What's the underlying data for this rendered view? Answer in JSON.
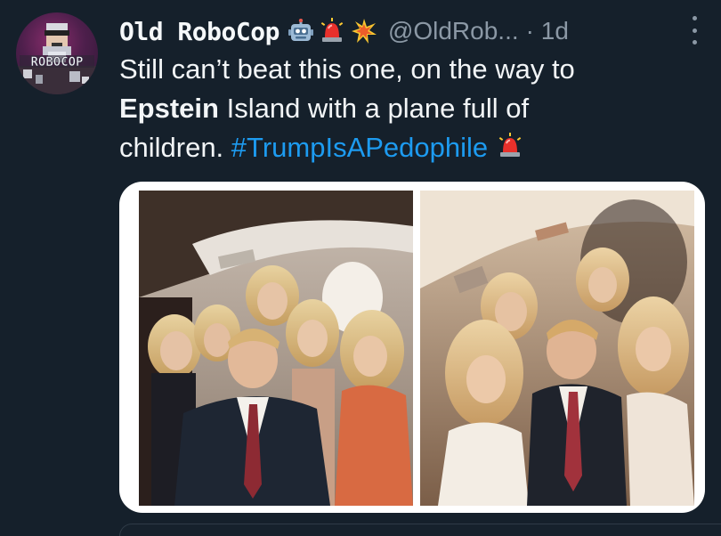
{
  "post": {
    "author": {
      "display_name": "Old RoboCop",
      "handle": "@OldRob...",
      "avatar_text": "ROBOCOP",
      "badges": [
        "robot-emoji",
        "siren-emoji",
        "collision-emoji"
      ]
    },
    "timestamp": "· 1d",
    "more_icon": "more-vertical-icon",
    "text": {
      "line1": "Still can’t beat this one, on the way to",
      "bold_word": "Epstein",
      "line2_rest": " Island with a plane full of",
      "line3": "children. ",
      "hashtag": "#TrumpIsAPedophile",
      "trailing_emoji": "siren-emoji"
    },
    "media": {
      "photos": [
        "photo-left",
        "photo-right"
      ]
    }
  },
  "colors": {
    "background": "#15202b",
    "text": "#f2f5f7",
    "secondary": "#8b98a5",
    "hashtag": "#1d9bf0",
    "media_frame": "#ffffff"
  }
}
